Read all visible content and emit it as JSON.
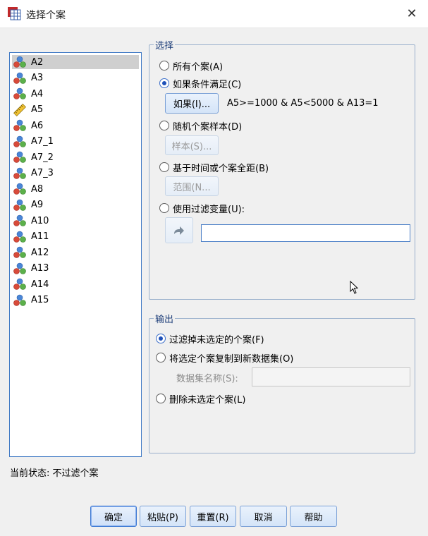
{
  "window": {
    "title": "选择个案",
    "close_symbol": "✕"
  },
  "variables": [
    {
      "name": "A2",
      "icon": "nominal-icon",
      "selected": true
    },
    {
      "name": "A3",
      "icon": "nominal-icon"
    },
    {
      "name": "A4",
      "icon": "nominal-icon"
    },
    {
      "name": "A5",
      "icon": "scale-ruler-icon"
    },
    {
      "name": "A6",
      "icon": "nominal-icon"
    },
    {
      "name": "A7_1",
      "icon": "nominal-icon"
    },
    {
      "name": "A7_2",
      "icon": "nominal-icon"
    },
    {
      "name": "A7_3",
      "icon": "nominal-icon"
    },
    {
      "name": "A8",
      "icon": "nominal-icon"
    },
    {
      "name": "A9",
      "icon": "nominal-icon"
    },
    {
      "name": "A10",
      "icon": "nominal-icon"
    },
    {
      "name": "A11",
      "icon": "nominal-icon"
    },
    {
      "name": "A12",
      "icon": "nominal-icon"
    },
    {
      "name": "A13",
      "icon": "nominal-icon"
    },
    {
      "name": "A14",
      "icon": "nominal-icon"
    },
    {
      "name": "A15",
      "icon": "nominal-icon"
    }
  ],
  "select_group": {
    "title": "选择",
    "all_cases": "所有个案(A)",
    "if_condition": "如果条件满足(C)",
    "if_button": "如果(I)...",
    "condition_text": "A5>=1000 & A5<5000 & A13=1",
    "random_sample": "随机个案样本(D)",
    "sample_button": "样本(S)...",
    "time_range": "基于时间或个案全距(B)",
    "range_button": "范围(N...",
    "filter_variable": "使用过滤变量(U):",
    "filter_value": "",
    "selected_option": "if_condition"
  },
  "output_group": {
    "title": "输出",
    "filter_out": "过滤掉未选定的个案(F)",
    "copy_to_dataset": "将选定个案复制到新数据集(O)",
    "dataset_name_label": "数据集名称(S):",
    "dataset_name_value": "",
    "delete_unselected": "删除未选定个案(L)",
    "selected_option": "filter_out"
  },
  "status": {
    "text": "当前状态: 不过滤个案"
  },
  "buttons": {
    "ok": "确定",
    "paste": "粘贴(P)",
    "reset": "重置(R)",
    "cancel": "取消",
    "help": "帮助"
  },
  "colors": {
    "accent": "#3f7ad4",
    "group_title": "#1f3f7a",
    "selection": "#cfcfcf"
  }
}
